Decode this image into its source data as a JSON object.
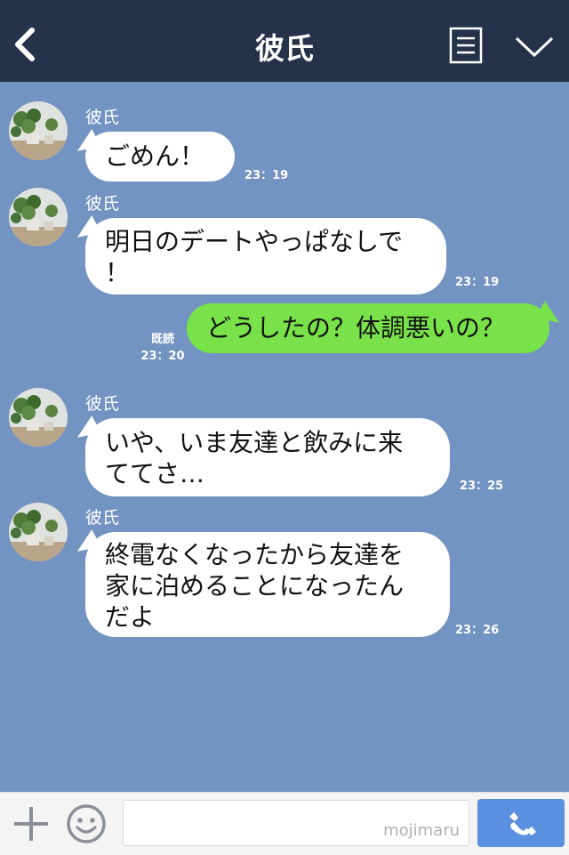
{
  "header": {
    "title": "彼氏"
  },
  "messages": [
    {
      "sender": "彼氏",
      "text": "ごめん！",
      "time": "23：19"
    },
    {
      "sender": "彼氏",
      "lines": [
        "明日のデートやっぱなしで",
        "！"
      ],
      "time": "23：19"
    },
    {
      "text": "どうしたの？体調悪いの？",
      "read": "既読",
      "time": "23：20"
    },
    {
      "sender": "彼氏",
      "lines": [
        "いや、いま友達と飲みに来",
        "ててさ…"
      ],
      "time": "23：25"
    },
    {
      "sender": "彼氏",
      "lines": [
        "終電なくなったから友達を",
        "家に泊めることになったん",
        "だよ"
      ],
      "time": "23：26"
    }
  ],
  "footer": {
    "watermark": "mojimaru"
  },
  "colors": {
    "header": "#263249",
    "chat_bg": "#7393c2",
    "outgoing": "#79e24a",
    "call": "#5b8fe0"
  },
  "icons": [
    "back-icon",
    "menu-icon",
    "chevron-down-icon",
    "plus-icon",
    "emoji-icon",
    "phone-icon"
  ]
}
